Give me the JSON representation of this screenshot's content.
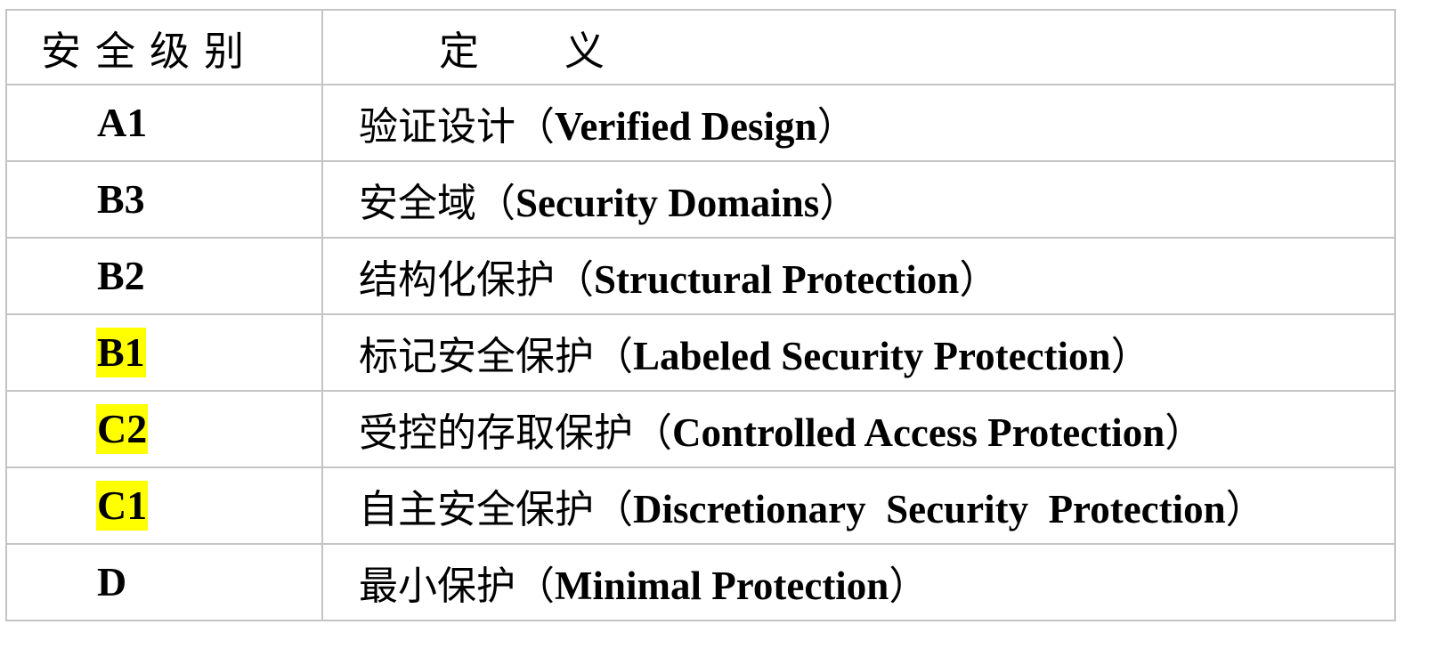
{
  "header": {
    "level": "安全级别",
    "definition": "定　　义"
  },
  "highlight_color": "#ffff00",
  "rows": [
    {
      "level": "A1",
      "cn": "验证设计",
      "open": "（",
      "en": "Verified Design",
      "close": "）",
      "highlighted": false
    },
    {
      "level": "B3",
      "cn": "安全域",
      "open": "（",
      "en": "Security Domains",
      "close": "）",
      "highlighted": false
    },
    {
      "level": "B2",
      "cn": "结构化保护",
      "open": "（",
      "en": "Structural Protection",
      "close": "）",
      "highlighted": false
    },
    {
      "level": "B1",
      "cn": "标记安全保护",
      "open": "（",
      "en": "Labeled Security Protection",
      "close": "）",
      "highlighted": true
    },
    {
      "level": "C2",
      "cn": "受控的存取保护",
      "open": "（",
      "en": "Controlled Access Protection",
      "close": "）",
      "highlighted": true
    },
    {
      "level": "C1",
      "cn": "自主安全保护",
      "open": "（",
      "en": "Discretionary  Security  Protection",
      "close": "）",
      "highlighted": true
    },
    {
      "level": "D",
      "cn": "最小保护",
      "open": "（",
      "en": "Minimal Protection",
      "close": "）",
      "highlighted": false
    }
  ]
}
